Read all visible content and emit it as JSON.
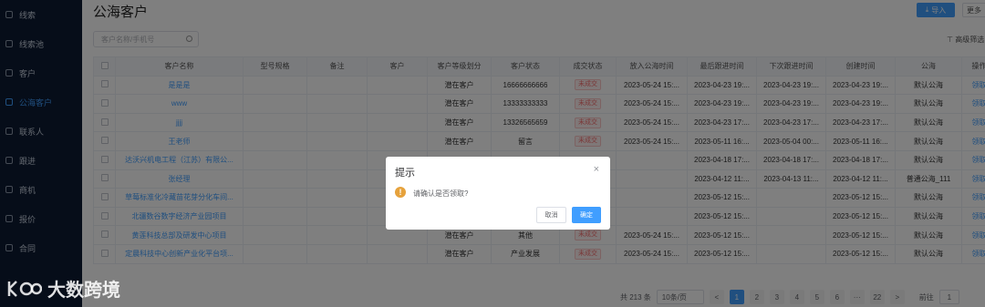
{
  "sidebar": {
    "items": [
      {
        "label": "线索"
      },
      {
        "label": "线索池"
      },
      {
        "label": "客户"
      },
      {
        "label": "公海客户",
        "active": true
      },
      {
        "label": "联系人"
      },
      {
        "label": "跟进"
      },
      {
        "label": "商机"
      },
      {
        "label": "报价"
      },
      {
        "label": "合同"
      }
    ]
  },
  "header": {
    "title": "公海客户",
    "import_label": "导入",
    "more_label": "更多"
  },
  "search": {
    "placeholder": "客户名称/手机号"
  },
  "advanced_filter_label": "高级筛选",
  "table": {
    "columns": [
      "客户名称",
      "型号规格",
      "备注",
      "客户",
      "客户等级划分",
      "客户状态",
      "成交状态",
      "放入公海时间",
      "最后跟进时间",
      "下次跟进时间",
      "创建时间",
      "公海",
      "操作"
    ],
    "rows": [
      {
        "name": "是是是",
        "level": "潜在客户",
        "status": "16666666666",
        "deal": "未成交",
        "pool_time": "2023-05-24 15:...",
        "last_follow": "2023-04-23 19:...",
        "next_follow": "2023-04-23 19:...",
        "created": "2023-04-23 19:...",
        "sea": "默认公海",
        "op": "领取"
      },
      {
        "name": "www",
        "level": "潜在客户",
        "status": "13333333333",
        "deal": "未成交",
        "pool_time": "2023-05-24 15:...",
        "last_follow": "2023-04-23 19:...",
        "next_follow": "2023-04-23 19:...",
        "created": "2023-04-23 19:...",
        "sea": "默认公海",
        "op": "领取"
      },
      {
        "name": "jjjj",
        "level": "潜在客户",
        "status": "13326565659",
        "deal": "未成交",
        "pool_time": "2023-05-24 15:...",
        "last_follow": "2023-04-23 17:...",
        "next_follow": "2023-04-23 17:...",
        "created": "2023-04-23 17:...",
        "sea": "默认公海",
        "op": "领取"
      },
      {
        "name": "王老师",
        "level": "潜在客户",
        "status": "留言",
        "deal": "未成交",
        "pool_time": "2023-05-24 15:...",
        "last_follow": "2023-05-11 16:...",
        "next_follow": "2023-05-04 00:...",
        "created": "2023-05-11 16:...",
        "sea": "默认公海",
        "op": "领取"
      },
      {
        "name": "达沃兴机电工程（江苏）有限公...",
        "level": "",
        "status": "",
        "deal": "",
        "pool_time": "",
        "last_follow": "2023-04-18 17:...",
        "next_follow": "2023-04-18 17:...",
        "created": "2023-04-18 17:...",
        "sea": "默认公海",
        "op": "领取"
      },
      {
        "name": "张经理",
        "level": "",
        "status": "",
        "deal": "",
        "pool_time": "",
        "last_follow": "2023-04-12 11:...",
        "next_follow": "2023-04-13 11:...",
        "created": "2023-04-12 11:...",
        "sea": "普通公海_111",
        "op": "领取"
      },
      {
        "name": "草莓标准化冷藏苗花芽分化车间...",
        "level": "",
        "status": "",
        "deal": "",
        "pool_time": "",
        "last_follow": "2023-05-12 15:...",
        "next_follow": "",
        "created": "2023-05-12 15:...",
        "sea": "默认公海",
        "op": "领取"
      },
      {
        "name": "北疆数谷数字经济产业园项目",
        "level": "",
        "status": "",
        "deal": "",
        "pool_time": "",
        "last_follow": "2023-05-12 15:...",
        "next_follow": "",
        "created": "2023-05-12 15:...",
        "sea": "默认公海",
        "op": "领取"
      },
      {
        "name": "黄莲科技总部及研发中心项目",
        "level": "潜在客户",
        "status": "其他",
        "deal": "未成交",
        "pool_time": "2023-05-24 15:...",
        "last_follow": "2023-05-12 15:...",
        "next_follow": "",
        "created": "2023-05-12 15:...",
        "sea": "默认公海",
        "op": "领取"
      },
      {
        "name": "定晨科技中心创新产业化平台项...",
        "level": "潜在客户",
        "status": "产业发展",
        "deal": "未成交",
        "pool_time": "2023-05-24 15:...",
        "last_follow": "2023-05-12 15:...",
        "next_follow": "",
        "created": "2023-05-12 15:...",
        "sea": "默认公海",
        "op": "领取"
      }
    ]
  },
  "pagination": {
    "total": "共 213 条",
    "page_size": "10条/页",
    "prev": "<",
    "pages": [
      "1",
      "2",
      "3",
      "4",
      "5",
      "6",
      "···",
      "22"
    ],
    "next": ">",
    "goto_label": "前往",
    "goto_value": "1"
  },
  "dialog": {
    "title": "提示",
    "close": "×",
    "icon_text": "!",
    "message": "请确认是否领取?",
    "cancel_label": "取消",
    "ok_label": "确定"
  },
  "watermark": {
    "text": "大数跨境"
  },
  "colors": {
    "primary": "#409eff",
    "sidebar_bg": "#0c1a33",
    "warning": "#e6a23c",
    "danger": "#f56c6c"
  },
  "icons": [
    "sidebar-item-icon",
    "import-icon",
    "search-icon",
    "filter-icon",
    "warning-icon",
    "close-icon"
  ]
}
